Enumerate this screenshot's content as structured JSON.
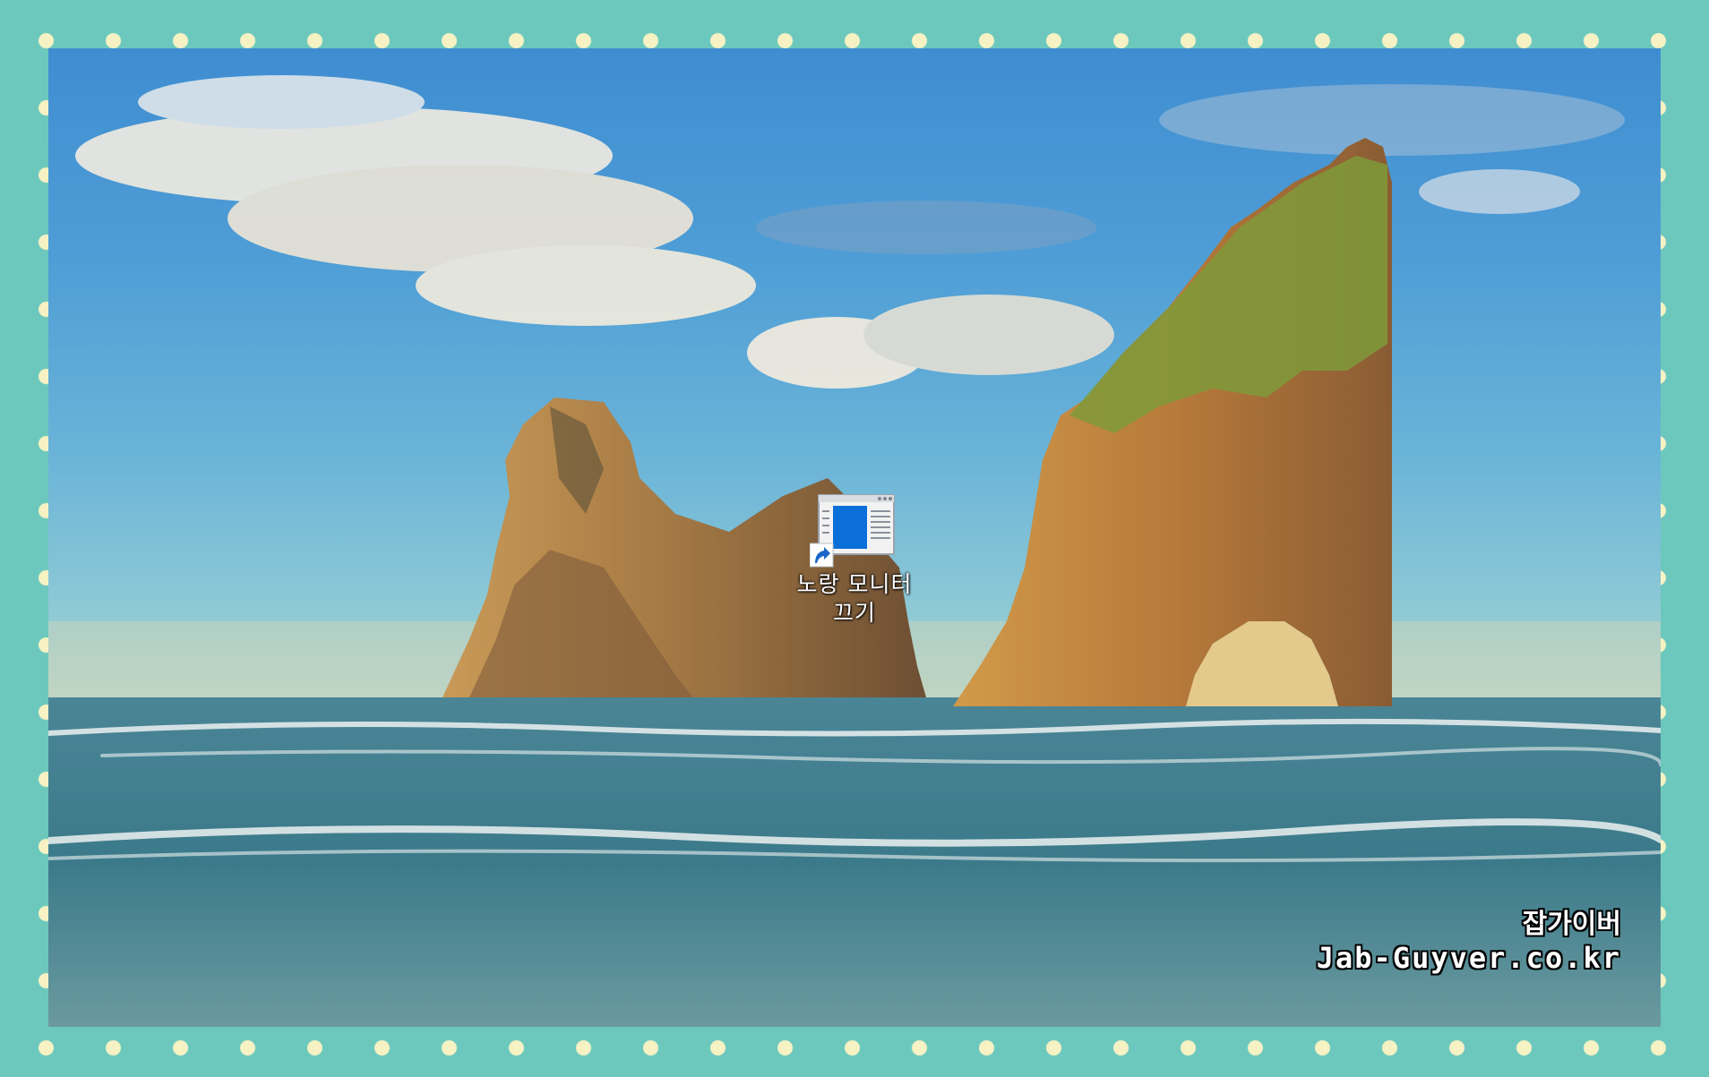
{
  "desktop": {
    "shortcut": {
      "label": "노랑 모니터\n끄기",
      "icon": "app-window-icon",
      "overlay": "shortcut-arrow-icon"
    }
  },
  "watermark": {
    "line1": "잡가이버",
    "line2": "Jab-Guyver.co.kr"
  },
  "colors": {
    "frame": "#6cc8bd",
    "dots": "#f6f2c4",
    "icon_accent": "#0a6fd8"
  }
}
